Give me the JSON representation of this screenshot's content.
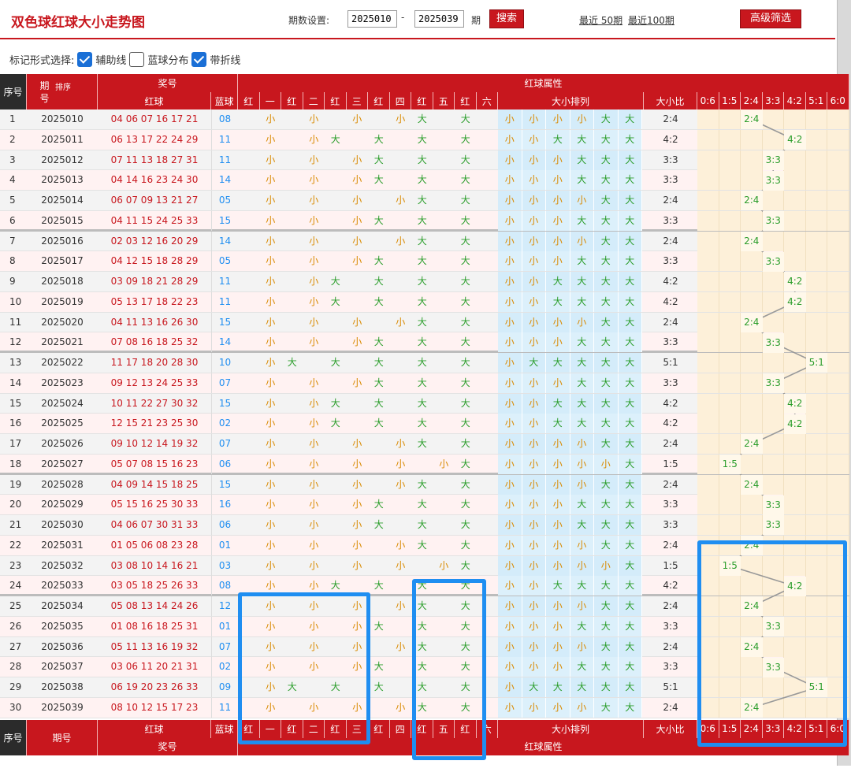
{
  "header": {
    "title": "双色球红球大小走势图",
    "range_label": "期数设置:",
    "from": "2025010",
    "dash": "-",
    "to": "2025039",
    "period_unit": "期",
    "search_btn": "搜索",
    "last50": "最近 50期",
    "last100": "最近100期",
    "advanced_btn": "高级筛选"
  },
  "marks": {
    "label": "标记形式选择:",
    "opt1": "辅助线",
    "opt2": "蓝球分布",
    "opt3": "带折线",
    "checked": [
      true,
      false,
      true
    ]
  },
  "thead": {
    "seq": "序号",
    "issue": "期号",
    "sort": "排序",
    "award": "奖号",
    "red": "红球",
    "blue": "蓝球",
    "attr": "红球属性",
    "sizes_title": "大小排列",
    "ratio_title": "大小比",
    "pos_labels": [
      "红",
      "一",
      "红",
      "二",
      "红",
      "三",
      "红",
      "四",
      "红",
      "五",
      "红",
      "六"
    ],
    "ratios": [
      "0:6",
      "1:5",
      "2:4",
      "3:3",
      "4:2",
      "5:1",
      "6:0"
    ],
    "issue_top": "期",
    "issue_bottom": "号"
  },
  "colors": {
    "red": "#c8171e",
    "small": "#d98a00",
    "big": "#2a9d2a",
    "blue": "#1f8ef1"
  },
  "rows": [
    {
      "n": "1",
      "issue": "2025010",
      "red": "04 06 07 16 17 21",
      "blue": "08",
      "s": "小小小小大大",
      "ratio": "2:4"
    },
    {
      "n": "2",
      "issue": "2025011",
      "red": "06 13 17 22 24 29",
      "blue": "11",
      "s": "小小大大大大",
      "ratio": "4:2"
    },
    {
      "n": "3",
      "issue": "2025012",
      "red": "07 11 13 18 27 31",
      "blue": "11",
      "s": "小小小大大大",
      "ratio": "3:3"
    },
    {
      "n": "4",
      "issue": "2025013",
      "red": "04 14 16 23 24 30",
      "blue": "14",
      "s": "小小小大大大",
      "ratio": "3:3"
    },
    {
      "n": "5",
      "issue": "2025014",
      "red": "06 07 09 13 21 27",
      "blue": "05",
      "s": "小小小小大大",
      "ratio": "2:4"
    },
    {
      "n": "6",
      "issue": "2025015",
      "red": "04 11 15 24 25 33",
      "blue": "15",
      "s": "小小小大大大",
      "ratio": "3:3"
    },
    {
      "n": "7",
      "issue": "2025016",
      "red": "02 03 12 16 20 29",
      "blue": "14",
      "s": "小小小小大大",
      "ratio": "2:4"
    },
    {
      "n": "8",
      "issue": "2025017",
      "red": "04 12 15 18 28 29",
      "blue": "05",
      "s": "小小小大大大",
      "ratio": "3:3"
    },
    {
      "n": "9",
      "issue": "2025018",
      "red": "03 09 18 21 28 29",
      "blue": "11",
      "s": "小小大大大大",
      "ratio": "4:2"
    },
    {
      "n": "10",
      "issue": "2025019",
      "red": "05 13 17 18 22 23",
      "blue": "11",
      "s": "小小大大大大",
      "ratio": "4:2"
    },
    {
      "n": "11",
      "issue": "2025020",
      "red": "04 11 13 16 26 30",
      "blue": "15",
      "s": "小小小小大大",
      "ratio": "2:4"
    },
    {
      "n": "12",
      "issue": "2025021",
      "red": "07 08 16 18 25 32",
      "blue": "14",
      "s": "小小小大大大",
      "ratio": "3:3"
    },
    {
      "n": "13",
      "issue": "2025022",
      "red": "11 17 18 20 28 30",
      "blue": "10",
      "s": "小大大大大大",
      "ratio": "5:1"
    },
    {
      "n": "14",
      "issue": "2025023",
      "red": "09 12 13 24 25 33",
      "blue": "07",
      "s": "小小小大大大",
      "ratio": "3:3"
    },
    {
      "n": "15",
      "issue": "2025024",
      "red": "10 11 22 27 30 32",
      "blue": "15",
      "s": "小小大大大大",
      "ratio": "4:2"
    },
    {
      "n": "16",
      "issue": "2025025",
      "red": "12 15 21 23 25 30",
      "blue": "02",
      "s": "小小大大大大",
      "ratio": "4:2"
    },
    {
      "n": "17",
      "issue": "2025026",
      "red": "09 10 12 14 19 32",
      "blue": "07",
      "s": "小小小小大大",
      "ratio": "2:4"
    },
    {
      "n": "18",
      "issue": "2025027",
      "red": "05 07 08 15 16 23",
      "blue": "06",
      "s": "小小小小小大",
      "ratio": "1:5"
    },
    {
      "n": "19",
      "issue": "2025028",
      "red": "04 09 14 15 18 25",
      "blue": "15",
      "s": "小小小小大大",
      "ratio": "2:4"
    },
    {
      "n": "20",
      "issue": "2025029",
      "red": "05 15 16 25 30 33",
      "blue": "16",
      "s": "小小小大大大",
      "ratio": "3:3"
    },
    {
      "n": "21",
      "issue": "2025030",
      "red": "04 06 07 30 31 33",
      "blue": "06",
      "s": "小小小大大大",
      "ratio": "3:3"
    },
    {
      "n": "22",
      "issue": "2025031",
      "red": "01 05 06 08 23 28",
      "blue": "01",
      "s": "小小小小大大",
      "ratio": "2:4"
    },
    {
      "n": "23",
      "issue": "2025032",
      "red": "03 08 10 14 16 21",
      "blue": "03",
      "s": "小小小小小大",
      "ratio": "1:5"
    },
    {
      "n": "24",
      "issue": "2025033",
      "red": "03 05 18 25 26 33",
      "blue": "08",
      "s": "小小大大大大",
      "ratio": "4:2"
    },
    {
      "n": "25",
      "issue": "2025034",
      "red": "05 08 13 14 24 26",
      "blue": "12",
      "s": "小小小小大大",
      "ratio": "2:4"
    },
    {
      "n": "26",
      "issue": "2025035",
      "red": "01 08 16 18 25 31",
      "blue": "01",
      "s": "小小小大大大",
      "ratio": "3:3"
    },
    {
      "n": "27",
      "issue": "2025036",
      "red": "05 11 13 16 19 32",
      "blue": "07",
      "s": "小小小小大大",
      "ratio": "2:4"
    },
    {
      "n": "28",
      "issue": "2025037",
      "red": "03 06 11 20 21 31",
      "blue": "02",
      "s": "小小小大大大",
      "ratio": "3:3"
    },
    {
      "n": "29",
      "issue": "2025038",
      "red": "06 19 20 23 26 33",
      "blue": "09",
      "s": "小大大大大大",
      "ratio": "5:1"
    },
    {
      "n": "30",
      "issue": "2025039",
      "red": "08 10 12 15 17 23",
      "blue": "11",
      "s": "小小小小大大",
      "ratio": "2:4"
    }
  ]
}
